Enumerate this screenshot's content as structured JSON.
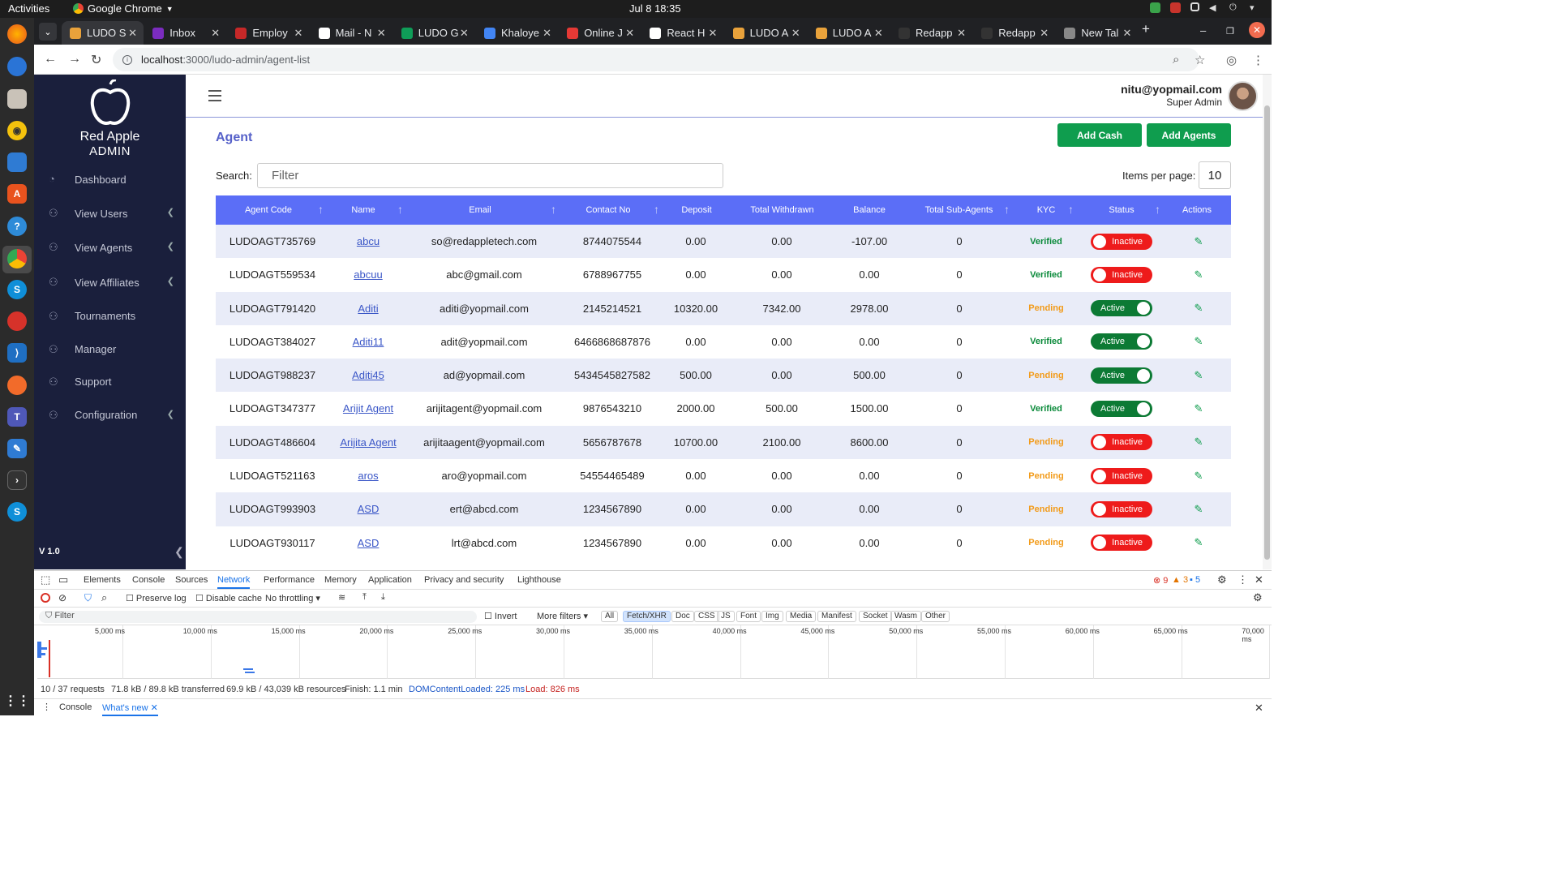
{
  "os": {
    "activities": "Activities",
    "app_name": "Google Chrome",
    "clock": "Jul 8  18:35"
  },
  "browser": {
    "tabs": [
      {
        "title": "LUDO S",
        "active": true
      },
      {
        "title": "Inbox"
      },
      {
        "title": "Employ"
      },
      {
        "title": "Mail - N"
      },
      {
        "title": "LUDO G"
      },
      {
        "title": "Khaloye"
      },
      {
        "title": "Online J"
      },
      {
        "title": "React H"
      },
      {
        "title": "LUDO A"
      },
      {
        "title": "LUDO A"
      },
      {
        "title": "Redapp"
      },
      {
        "title": "Redapp"
      },
      {
        "title": "New Tal"
      }
    ],
    "url_host": "localhost",
    "url_path": ":3000/ludo-admin/agent-list"
  },
  "sidebar": {
    "brand": "Red Apple",
    "brand_sub": "ADMIN",
    "items": [
      {
        "label": "Dashboard",
        "expandable": false
      },
      {
        "label": "View Users",
        "expandable": true
      },
      {
        "label": "View Agents",
        "expandable": true
      },
      {
        "label": "View Affiliates",
        "expandable": true
      },
      {
        "label": "Tournaments",
        "expandable": false
      },
      {
        "label": "Manager",
        "expandable": false
      },
      {
        "label": "Support",
        "expandable": false
      },
      {
        "label": "Configuration",
        "expandable": true
      }
    ],
    "version": "V 1.0"
  },
  "header": {
    "user_email": "nitu@yopmail.com",
    "user_role": "Super Admin"
  },
  "page": {
    "title": "Agent",
    "add_cash_label": "Add Cash",
    "add_agents_label": "Add Agents",
    "search_label": "Search:",
    "search_placeholder": "Filter",
    "items_per_page_label": "Items per page:",
    "items_per_page": "10"
  },
  "table": {
    "columns": [
      "Agent Code",
      "Name",
      "Email",
      "Contact No",
      "Deposit",
      "Total Withdrawn",
      "Balance",
      "Total Sub-Agents",
      "KYC",
      "Status",
      "Actions"
    ],
    "rows": [
      {
        "code": "LUDOAGT735769",
        "name": "abcu",
        "email": "so@redappletech.com",
        "contact": "8744075544",
        "deposit": "0.00",
        "withdrawn": "0.00",
        "balance": "-107.00",
        "subagents": "0",
        "kyc": "Verified",
        "status": "Inactive"
      },
      {
        "code": "LUDOAGT559534",
        "name": "abcuu",
        "email": "abc@gmail.com",
        "contact": "6788967755",
        "deposit": "0.00",
        "withdrawn": "0.00",
        "balance": "0.00",
        "subagents": "0",
        "kyc": "Verified",
        "status": "Inactive"
      },
      {
        "code": "LUDOAGT791420",
        "name": "Aditi",
        "email": "aditi@yopmail.com",
        "contact": "2145214521",
        "deposit": "10320.00",
        "withdrawn": "7342.00",
        "balance": "2978.00",
        "subagents": "0",
        "kyc": "Pending",
        "status": "Active"
      },
      {
        "code": "LUDOAGT384027",
        "name": "Aditi11",
        "email": "adit@yopmail.com",
        "contact": "6466868687876",
        "deposit": "0.00",
        "withdrawn": "0.00",
        "balance": "0.00",
        "subagents": "0",
        "kyc": "Verified",
        "status": "Active"
      },
      {
        "code": "LUDOAGT988237",
        "name": "Aditi45",
        "email": "ad@yopmail.com",
        "contact": "5434545827582",
        "deposit": "500.00",
        "withdrawn": "0.00",
        "balance": "500.00",
        "subagents": "0",
        "kyc": "Pending",
        "status": "Active"
      },
      {
        "code": "LUDOAGT347377",
        "name": "Arijit Agent",
        "email": "arijitagent@yopmail.com",
        "contact": "9876543210",
        "deposit": "2000.00",
        "withdrawn": "500.00",
        "balance": "1500.00",
        "subagents": "0",
        "kyc": "Verified",
        "status": "Active"
      },
      {
        "code": "LUDOAGT486604",
        "name": "Arijita Agent",
        "email": "arijitaagent@yopmail.com",
        "contact": "5656787678",
        "deposit": "10700.00",
        "withdrawn": "2100.00",
        "balance": "8600.00",
        "subagents": "0",
        "kyc": "Pending",
        "status": "Inactive"
      },
      {
        "code": "LUDOAGT521163",
        "name": "aros",
        "email": "aro@yopmail.com",
        "contact": "54554465489",
        "deposit": "0.00",
        "withdrawn": "0.00",
        "balance": "0.00",
        "subagents": "0",
        "kyc": "Pending",
        "status": "Inactive"
      },
      {
        "code": "LUDOAGT993903",
        "name": "ASD",
        "email": "ert@abcd.com",
        "contact": "1234567890",
        "deposit": "0.00",
        "withdrawn": "0.00",
        "balance": "0.00",
        "subagents": "0",
        "kyc": "Pending",
        "status": "Inactive"
      },
      {
        "code": "LUDOAGT930117",
        "name": "ASD",
        "email": "lrt@abcd.com",
        "contact": "1234567890",
        "deposit": "0.00",
        "withdrawn": "0.00",
        "balance": "0.00",
        "subagents": "0",
        "kyc": "Pending",
        "status": "Inactive"
      }
    ]
  },
  "devtools": {
    "tabs": [
      "Elements",
      "Console",
      "Sources",
      "Network",
      "Performance",
      "Memory",
      "Application",
      "Privacy and security",
      "Lighthouse"
    ],
    "active_tab": "Network",
    "errors": "9",
    "warnings": "3",
    "messages": "5",
    "preserve_log": "Preserve log",
    "disable_cache": "Disable cache",
    "throttling": "No throttling",
    "filter_placeholder": "Filter",
    "invert": "Invert",
    "more_filters": "More filters",
    "type_filters": [
      "All",
      "Fetch/XHR",
      "Doc",
      "CSS",
      "JS",
      "Font",
      "Img",
      "Media",
      "Manifest",
      "Socket",
      "Wasm",
      "Other"
    ],
    "selected_filter": "Fetch/XHR",
    "timeline_ticks": [
      "5,000 ms",
      "10,000 ms",
      "15,000 ms",
      "20,000 ms",
      "25,000 ms",
      "30,000 ms",
      "35,000 ms",
      "40,000 ms",
      "45,000 ms",
      "50,000 ms",
      "55,000 ms",
      "60,000 ms",
      "65,000 ms",
      "70,000 ms"
    ],
    "status": {
      "requests": "10 / 37 requests",
      "transferred": "71.8 kB / 89.8 kB transferred",
      "resources": "69.9 kB / 43,039 kB resources",
      "finish": "Finish: 1.1 min",
      "dcl": "DOMContentLoaded: 225 ms",
      "load": "Load: 826 ms"
    },
    "drawer_tabs": [
      "Console",
      "What's new"
    ]
  },
  "colors": {
    "sidebar_bg": "#1a1f3c",
    "table_header": "#5b6ef7",
    "accent_green": "#0f9d4e",
    "inactive_red": "#ee1b1b",
    "active_green": "#0c7a34",
    "title_blue": "#5661c9"
  }
}
